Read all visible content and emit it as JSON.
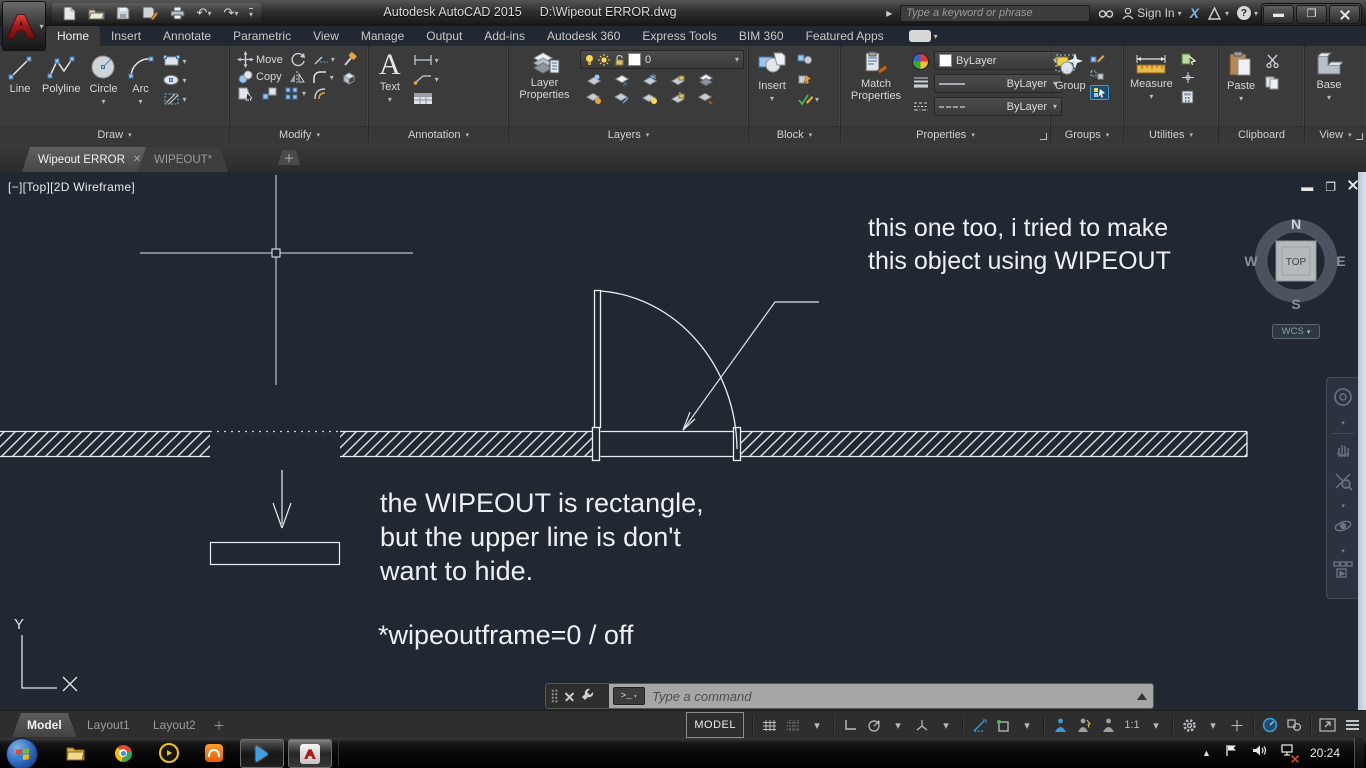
{
  "title_bar": {
    "app": "Autodesk AutoCAD 2015",
    "doc": "D:\\Wipeout ERROR.dwg",
    "search_placeholder": "Type a keyword or phrase",
    "sign_in": "Sign In"
  },
  "ribbon": {
    "tabs": [
      "Home",
      "Insert",
      "Annotate",
      "Parametric",
      "View",
      "Manage",
      "Output",
      "Add-ins",
      "Autodesk 360",
      "Express Tools",
      "BIM 360",
      "Featured Apps"
    ],
    "panels": {
      "draw": {
        "label": "Draw",
        "line": "Line",
        "polyline": "Polyline",
        "circle": "Circle",
        "arc": "Arc"
      },
      "modify": {
        "label": "Modify",
        "move": "Move",
        "copy": "Copy"
      },
      "annotation": {
        "label": "Annotation",
        "text": "Text"
      },
      "layers": {
        "label": "Layers",
        "layer_properties": "Layer Properties",
        "current_layer": "0"
      },
      "block": {
        "label": "Block",
        "insert": "Insert"
      },
      "properties": {
        "label": "Properties",
        "match": "Match Properties",
        "color": "ByLayer",
        "lineweight": "ByLayer",
        "linetype": "ByLayer"
      },
      "groups": {
        "label": "Groups",
        "group": "Group"
      },
      "utilities": {
        "label": "Utilities",
        "measure": "Measure"
      },
      "clipboard": {
        "label": "Clipboard",
        "paste": "Paste"
      },
      "view": {
        "label": "View",
        "base": "Base"
      }
    }
  },
  "file_tabs": {
    "active": "Wipeout ERROR",
    "inactive": "WIPEOUT*"
  },
  "viewport": {
    "label": "[−][Top][2D Wireframe]",
    "viewcube": {
      "n": "N",
      "s": "S",
      "e": "E",
      "w": "W",
      "top": "TOP",
      "wcs": "WCS"
    },
    "ucs_y": "Y",
    "notes": {
      "top_line1": "this one too, i tried to make",
      "top_line2": "this object using WIPEOUT",
      "mid_line1": "the WIPEOUT is rectangle,",
      "mid_line2": "but the upper line is don't",
      "mid_line3": "want to hide.",
      "sysvar": "*wipeoutframe=0 / off"
    }
  },
  "command_line": {
    "placeholder": "Type a command"
  },
  "status_bar": {
    "tabs": [
      "Model",
      "Layout1",
      "Layout2"
    ],
    "model": "MODEL",
    "scale": "1:1"
  },
  "taskbar": {
    "time": "20:24"
  },
  "colors": {
    "accent_blue": "#3d9ad3",
    "canvas_bg": "#212831",
    "line_color": "#e9eef3"
  }
}
